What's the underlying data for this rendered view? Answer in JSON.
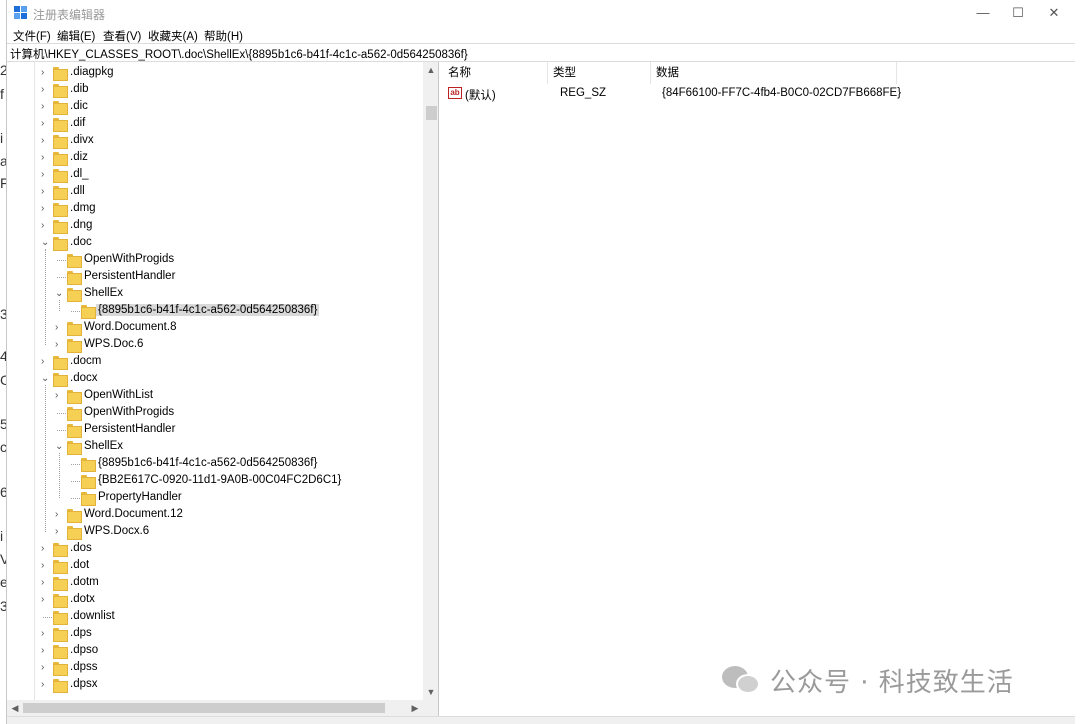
{
  "window": {
    "title": "注册表编辑器",
    "minimize": "—",
    "maximize": "☐",
    "close": "✕"
  },
  "menu": [
    "文件(F)",
    "编辑(E)",
    "查看(V)",
    "收藏夹(A)",
    "帮助(H)"
  ],
  "address": "计算机\\HKEY_CLASSES_ROOT\\.doc\\ShellEx\\{8895b1c6-b41f-4c1c-a562-0d564250836f}",
  "tree": [
    {
      "label": ".diagpkg",
      "level": 0,
      "expander": "collapsed"
    },
    {
      "label": ".dib",
      "level": 0,
      "expander": "collapsed"
    },
    {
      "label": ".dic",
      "level": 0,
      "expander": "collapsed"
    },
    {
      "label": ".dif",
      "level": 0,
      "expander": "collapsed"
    },
    {
      "label": ".divx",
      "level": 0,
      "expander": "collapsed"
    },
    {
      "label": ".diz",
      "level": 0,
      "expander": "collapsed"
    },
    {
      "label": ".dl_",
      "level": 0,
      "expander": "collapsed"
    },
    {
      "label": ".dll",
      "level": 0,
      "expander": "collapsed"
    },
    {
      "label": ".dmg",
      "level": 0,
      "expander": "collapsed"
    },
    {
      "label": ".dng",
      "level": 0,
      "expander": "collapsed"
    },
    {
      "label": ".doc",
      "level": 0,
      "expander": "expanded"
    },
    {
      "label": "OpenWithProgids",
      "level": 1,
      "expander": "none"
    },
    {
      "label": "PersistentHandler",
      "level": 1,
      "expander": "none"
    },
    {
      "label": "ShellEx",
      "level": 1,
      "expander": "expanded"
    },
    {
      "label": "{8895b1c6-b41f-4c1c-a562-0d564250836f}",
      "level": 2,
      "expander": "none",
      "selected": true
    },
    {
      "label": "Word.Document.8",
      "level": 1,
      "expander": "collapsed"
    },
    {
      "label": "WPS.Doc.6",
      "level": 1,
      "expander": "collapsed"
    },
    {
      "label": ".docm",
      "level": 0,
      "expander": "collapsed"
    },
    {
      "label": ".docx",
      "level": 0,
      "expander": "expanded"
    },
    {
      "label": "OpenWithList",
      "level": 1,
      "expander": "collapsed"
    },
    {
      "label": "OpenWithProgids",
      "level": 1,
      "expander": "none"
    },
    {
      "label": "PersistentHandler",
      "level": 1,
      "expander": "none"
    },
    {
      "label": "ShellEx",
      "level": 1,
      "expander": "expanded"
    },
    {
      "label": "{8895b1c6-b41f-4c1c-a562-0d564250836f}",
      "level": 2,
      "expander": "none"
    },
    {
      "label": "{BB2E617C-0920-11d1-9A0B-00C04FC2D6C1}",
      "level": 2,
      "expander": "none"
    },
    {
      "label": "PropertyHandler",
      "level": 2,
      "expander": "none"
    },
    {
      "label": "Word.Document.12",
      "level": 1,
      "expander": "collapsed"
    },
    {
      "label": "WPS.Docx.6",
      "level": 1,
      "expander": "collapsed"
    },
    {
      "label": ".dos",
      "level": 0,
      "expander": "collapsed"
    },
    {
      "label": ".dot",
      "level": 0,
      "expander": "collapsed"
    },
    {
      "label": ".dotm",
      "level": 0,
      "expander": "collapsed"
    },
    {
      "label": ".dotx",
      "level": 0,
      "expander": "collapsed"
    },
    {
      "label": ".downlist",
      "level": 0,
      "expander": "none"
    },
    {
      "label": ".dps",
      "level": 0,
      "expander": "collapsed"
    },
    {
      "label": ".dpso",
      "level": 0,
      "expander": "collapsed"
    },
    {
      "label": ".dpss",
      "level": 0,
      "expander": "collapsed"
    },
    {
      "label": ".dpsx",
      "level": 0,
      "expander": "collapsed"
    }
  ],
  "list": {
    "headers": [
      "名称",
      "类型",
      "数据"
    ],
    "rows": [
      {
        "icon": "ab",
        "name": "(默认)",
        "type": "REG_SZ",
        "data": "{84F66100-FF7C-4fb4-B0C0-02CD7FB668FE}"
      }
    ]
  },
  "scroll_arrows": {
    "up": "▲",
    "down": "▼",
    "left": "◀",
    "right": "▶"
  },
  "background_doc_chars": [
    "2",
    "f",
    "i",
    "a",
    "F",
    "3",
    "4",
    "C",
    "5",
    "c",
    "6",
    "i",
    "V",
    "e",
    "3"
  ],
  "watermark": "公众号 · 科技致生活",
  "colors": {
    "folder": "#f6cf55",
    "selection": "#d9d9d9",
    "app_icon": "#1e6fd9"
  }
}
